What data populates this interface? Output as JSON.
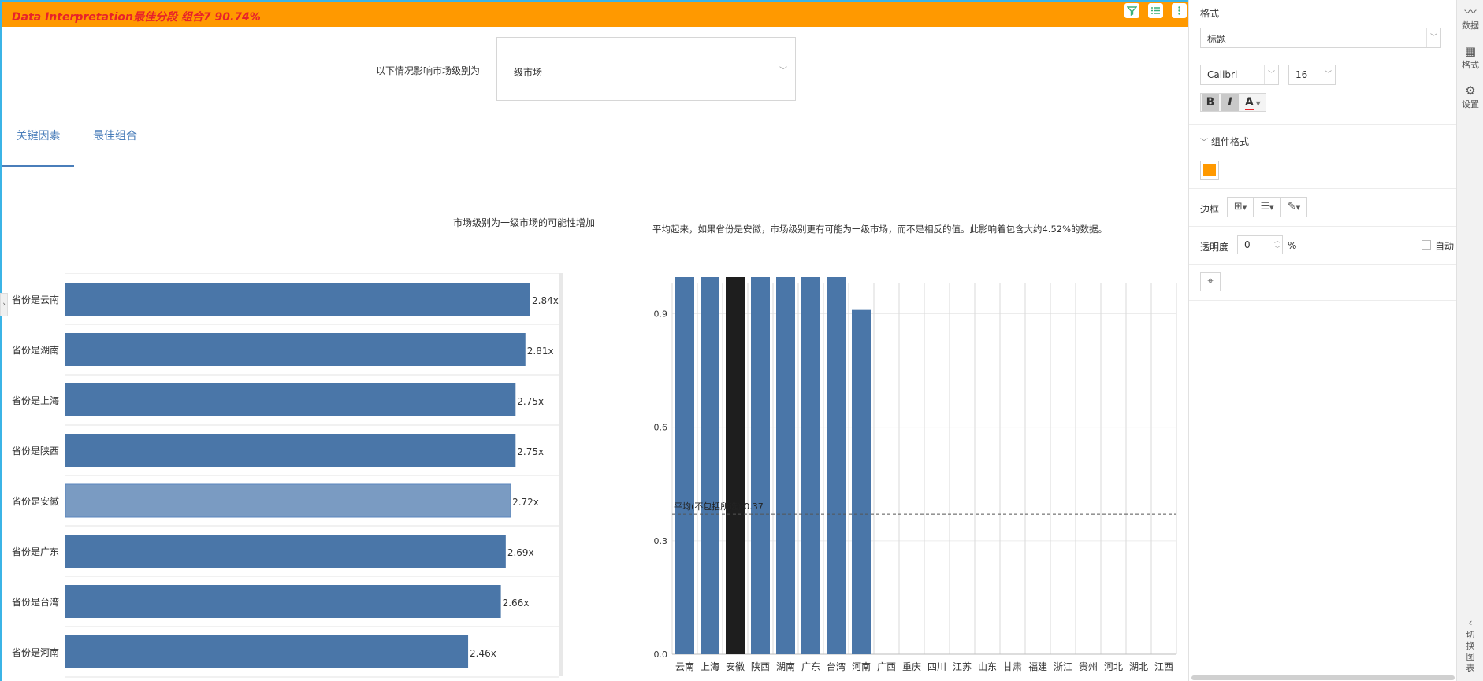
{
  "title_bar": {
    "title": "Data Interpretation最佳分段 组合7 90.74%",
    "filter_icon": "filter-icon",
    "list_icon": "list-icon",
    "more_icon": "more-vertical-icon"
  },
  "filter": {
    "label": "以下情况影响市场级别为",
    "value": "一级市场"
  },
  "tabs": [
    {
      "label": "关键因素",
      "active": true
    },
    {
      "label": "最佳组合",
      "active": false
    }
  ],
  "left_chart_title": "市场级别为一级市场的可能性增加",
  "right_note": "平均起来，如果省份是安徽，市场级别更有可能为一级市场，而不是相反的值。此影响着包含大约4.52%的数据。",
  "chart_data": [
    {
      "type": "bar",
      "orientation": "horizontal",
      "title": "市场级别为一级市场的可能性增加",
      "categories": [
        "省份是云南",
        "省份是湖南",
        "省份是上海",
        "省份是陕西",
        "省份是安徽",
        "省份是广东",
        "省份是台湾",
        "省份是河南"
      ],
      "values": [
        2.84,
        2.81,
        2.75,
        2.75,
        2.72,
        2.69,
        2.66,
        2.46
      ],
      "value_labels": [
        "2.84x",
        "2.81x",
        "2.75x",
        "2.75x",
        "2.72x",
        "2.69x",
        "2.66x",
        "2.46x"
      ],
      "highlighted": "省份是安徽",
      "bar_color": "#4a76a8",
      "highlight_color": "#7a9bc2",
      "xlim": [
        0,
        3
      ]
    },
    {
      "type": "bar",
      "categories": [
        "云南",
        "上海",
        "安徽",
        "陕西",
        "湖南",
        "广东",
        "台湾",
        "河南",
        "广西",
        "重庆",
        "四川",
        "江苏",
        "山东",
        "甘肃",
        "福建",
        "浙江",
        "贵州",
        "河北",
        "湖北",
        "江西"
      ],
      "values": [
        1.0,
        1.0,
        1.0,
        1.0,
        1.0,
        1.0,
        1.0,
        0.91,
        0,
        0,
        0,
        0,
        0,
        0,
        0,
        0,
        0,
        0,
        0,
        0
      ],
      "highlighted": "安徽",
      "bar_color": "#4a76a8",
      "highlight_color": "#1e1e1e",
      "yticks": [
        "0.0",
        "0.3",
        "0.6",
        "0.9"
      ],
      "ylim": [
        0,
        0.98
      ],
      "reference_line": {
        "value": 0.37,
        "label": "平均(不包括所选):0.37"
      }
    }
  ],
  "panel": {
    "heading": "格式",
    "title_select": "标题",
    "font_family": "Calibri",
    "font_size": "16",
    "bold": "B",
    "italic": "I",
    "font_color_label": "A",
    "component_format": "组件格式",
    "swatch_color": "#ff9900",
    "border_label": "边框",
    "opacity_label": "透明度",
    "opacity_value": "0",
    "percent": "%",
    "auto_label": "自动"
  },
  "sidenav": {
    "data": "数据",
    "format": "格式",
    "settings": "设置",
    "switch_chart": "切换图表"
  }
}
